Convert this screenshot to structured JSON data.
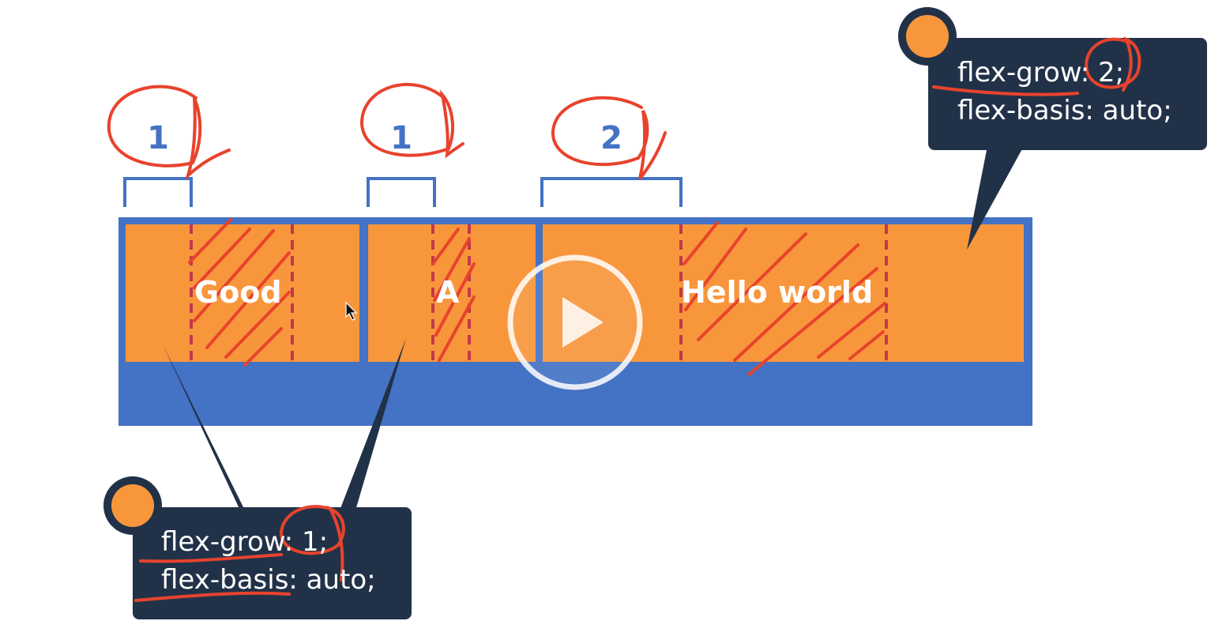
{
  "diagram": {
    "colors": {
      "container_blue": "#4472c4",
      "item_orange": "#f8963c",
      "callout_navy": "#213248",
      "annotation_red": "#e8432d",
      "dashed_red": "#c0394a"
    },
    "brackets": [
      {
        "label": "1"
      },
      {
        "label": "1"
      },
      {
        "label": "2"
      }
    ],
    "items": [
      {
        "text": "Good"
      },
      {
        "text": "A"
      },
      {
        "text": "Hello world"
      }
    ],
    "callouts": {
      "top_right": {
        "line1": "flex-grow: 2;",
        "line2": "flex-basis: auto;"
      },
      "bottom_left": {
        "line1": "flex-grow: 1;",
        "line2": "flex-basis: auto;"
      }
    }
  },
  "player": {
    "play_icon": "play-icon"
  }
}
